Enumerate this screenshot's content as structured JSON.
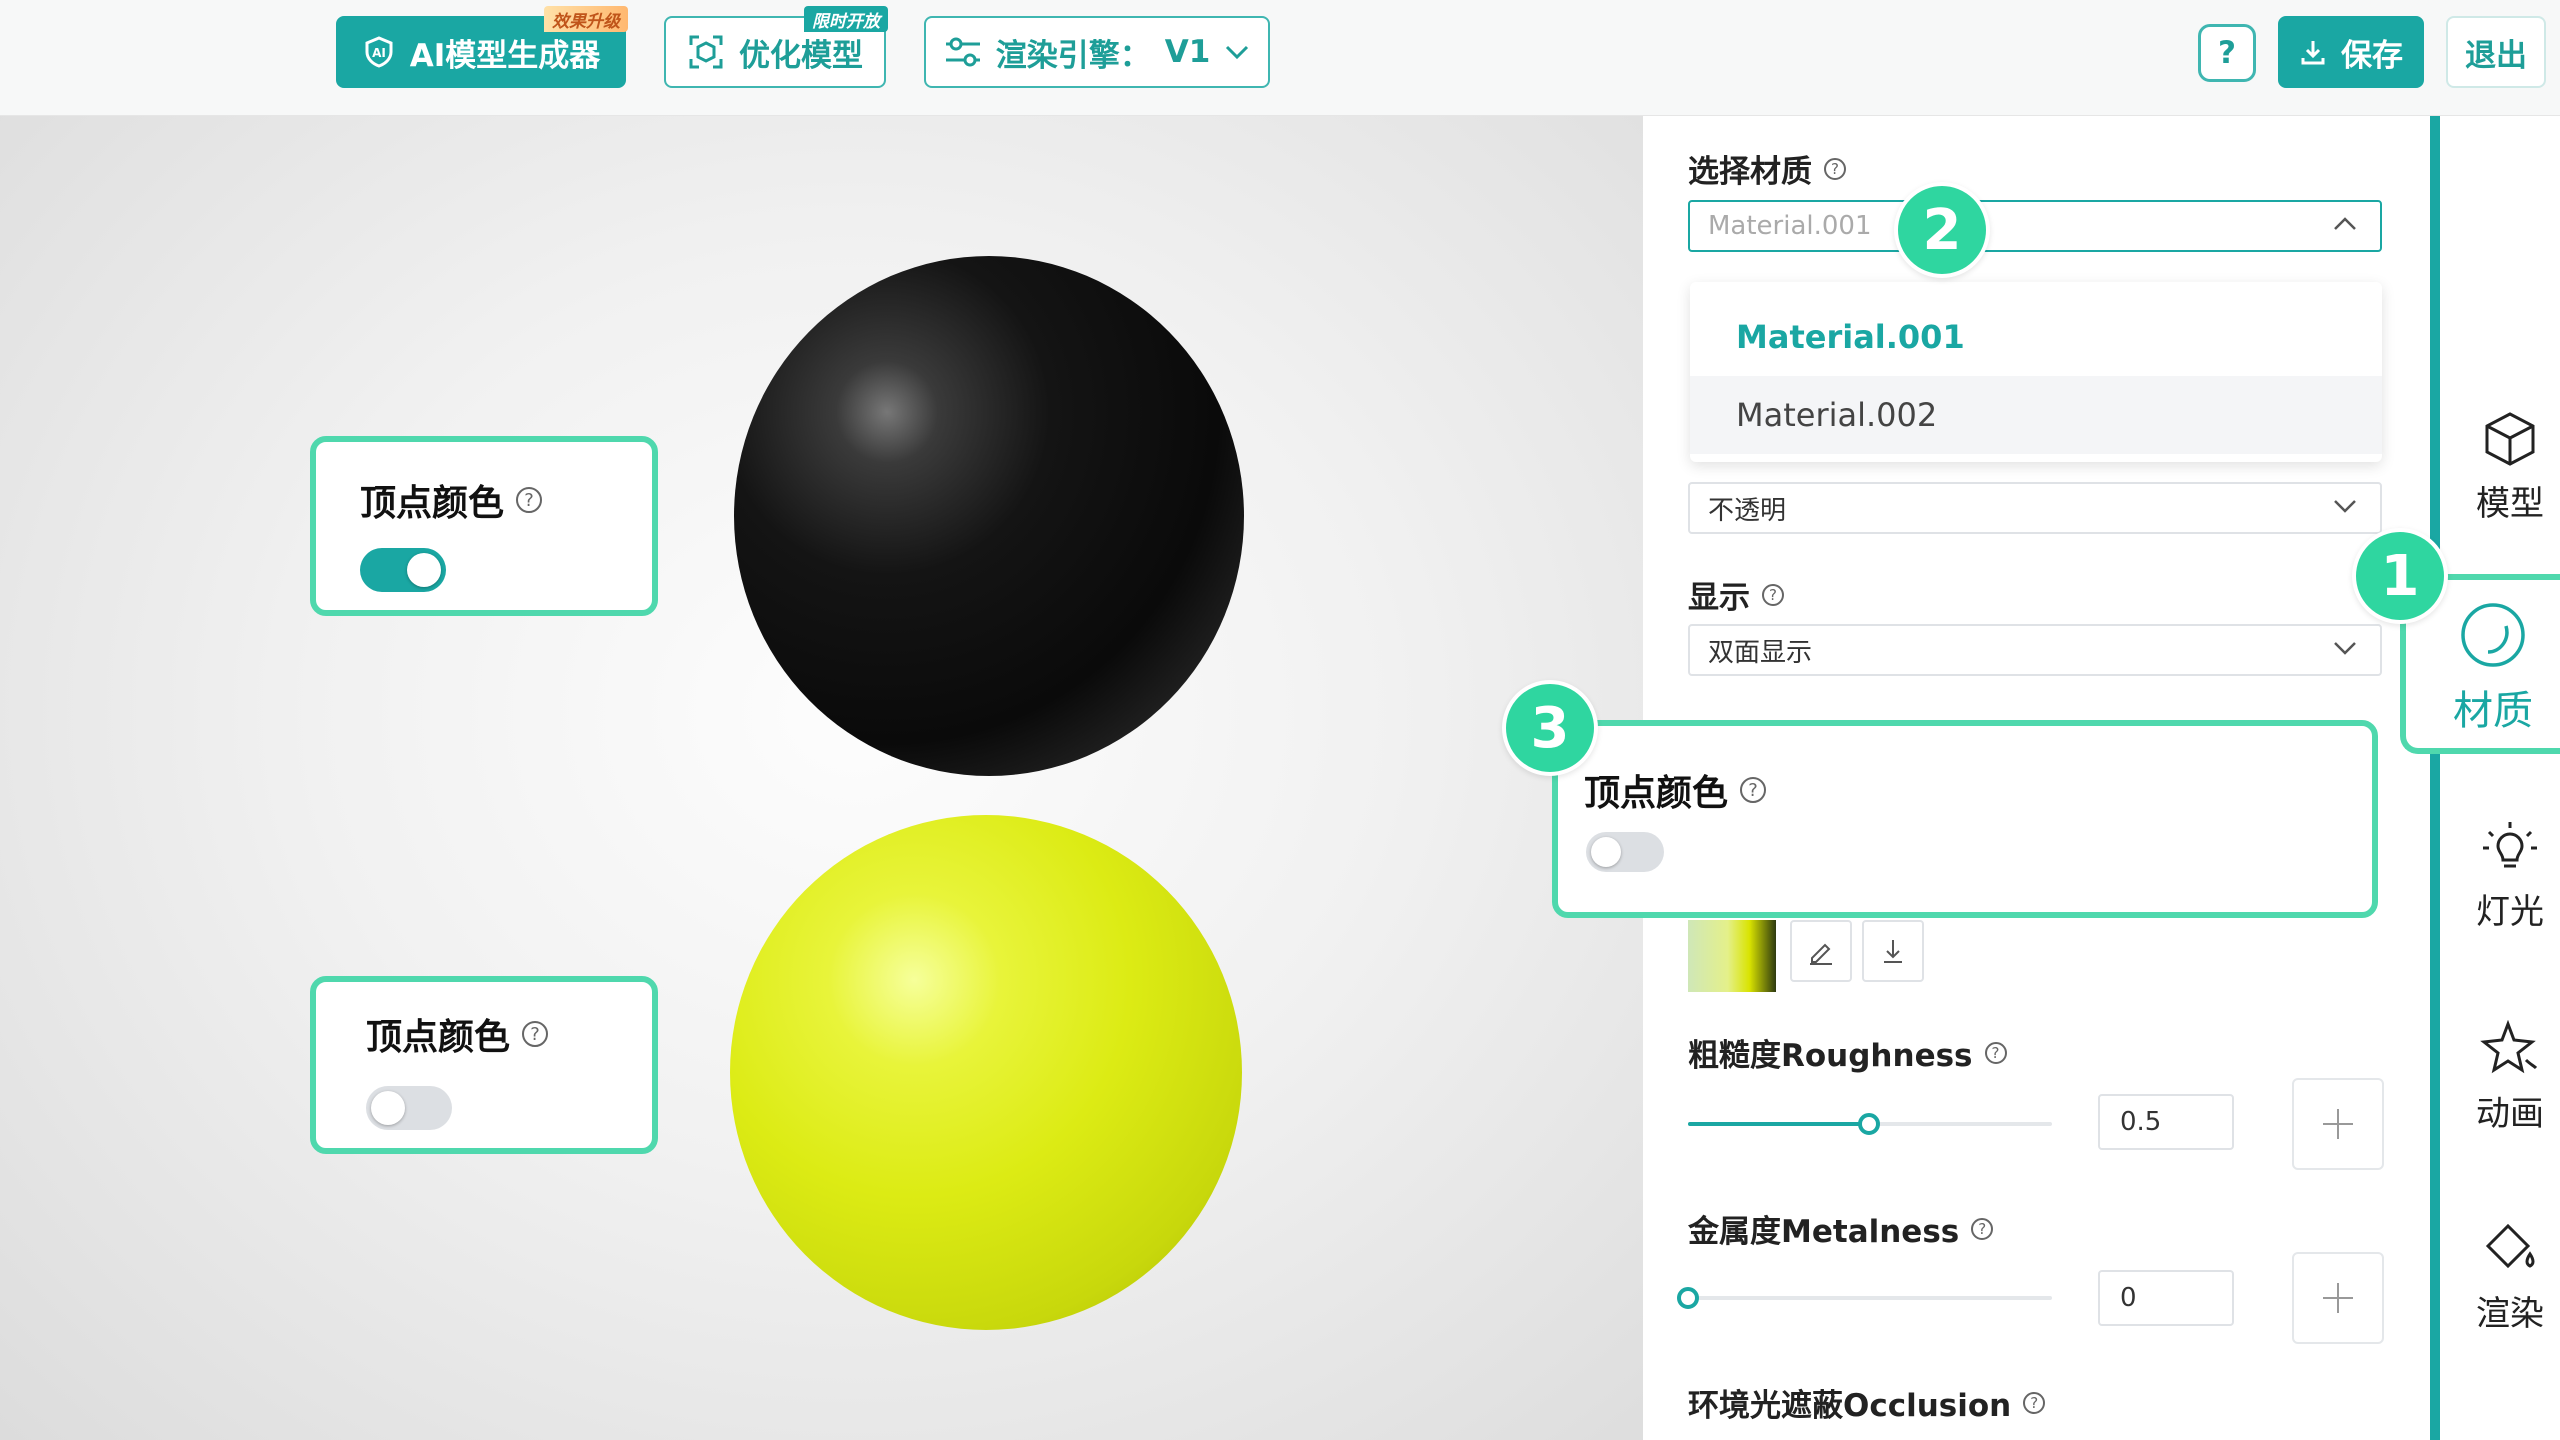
{
  "toolbar": {
    "ai_generator_label": "AI模型生成器",
    "ai_generator_tag": "效果升级",
    "optimize_label": "优化模型",
    "optimize_tag": "限时开放",
    "render_engine_label": "渲染引擎：",
    "render_engine_value": "V1",
    "help_label": "?",
    "save_label": "保存",
    "exit_label": "退出",
    "accent_color": "#1aa7a3"
  },
  "viewport": {
    "callout_top": {
      "title": "顶点颜色",
      "toggle_on": true
    },
    "callout_bottom": {
      "title": "顶点颜色",
      "toggle_on": false
    }
  },
  "panel": {
    "select_material_label": "选择材质",
    "material_value": "Material.001",
    "dropdown_options": [
      "Material.001",
      "Material.002"
    ],
    "transparency_value": "不透明",
    "display_label": "显示",
    "display_value": "双面显示",
    "vertex_color_label": "顶点颜色",
    "vertex_color_on": false,
    "roughness_label": "粗糙度Roughness",
    "roughness_value": "0.5",
    "roughness_level": 0.5,
    "metalness_label": "金属度Metalness",
    "metalness_value": "0",
    "metalness_level": 0,
    "occlusion_label": "环境光遮蔽Occlusion"
  },
  "badges": {
    "b1": "1",
    "b2": "2",
    "b3": "3"
  },
  "right_nav": [
    {
      "label": "模型",
      "icon": "cube-icon"
    },
    {
      "label": "材质",
      "icon": "material-sphere-icon",
      "active": true
    },
    {
      "label": "灯光",
      "icon": "light-bulb-icon"
    },
    {
      "label": "动画",
      "icon": "star-animation-icon"
    },
    {
      "label": "渲染",
      "icon": "paint-bucket-icon"
    }
  ]
}
